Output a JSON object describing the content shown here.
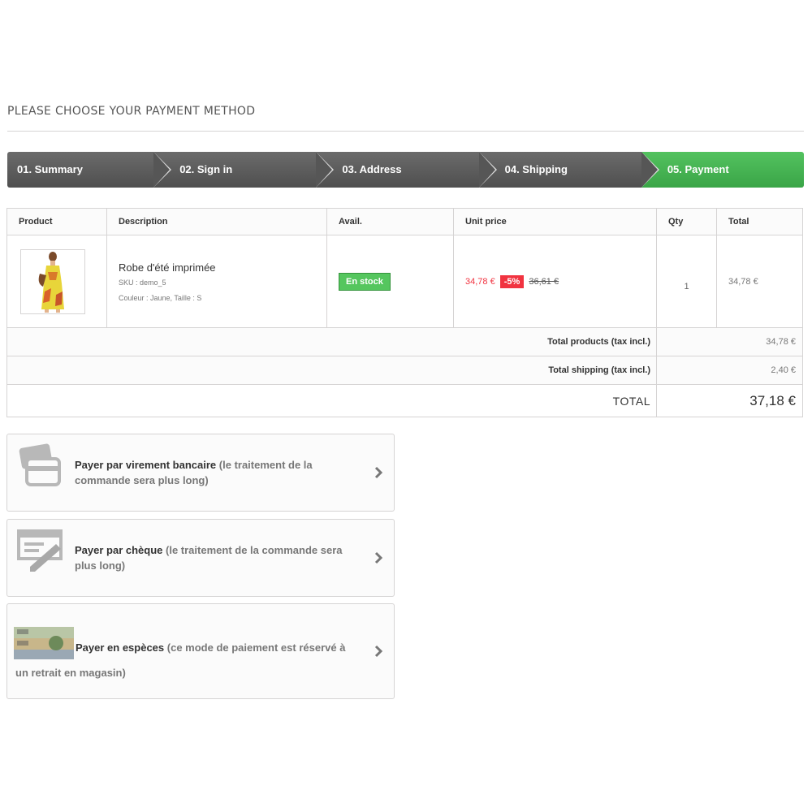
{
  "page": {
    "title": "PLEASE CHOOSE YOUR PAYMENT METHOD"
  },
  "steps": [
    {
      "label": "01. Summary",
      "active": false
    },
    {
      "label": "02. Sign in",
      "active": false
    },
    {
      "label": "03. Address",
      "active": false
    },
    {
      "label": "04. Shipping",
      "active": false
    },
    {
      "label": "05. Payment",
      "active": true
    }
  ],
  "cart": {
    "headers": [
      "Product",
      "Description",
      "Avail.",
      "Unit price",
      "Qty",
      "Total"
    ],
    "item": {
      "name": "Robe d'été imprimée",
      "sku": "SKU : demo_5",
      "attributes": "Couleur : Jaune, Taille : S",
      "availability": "En stock",
      "price": "34,78 €",
      "discount": "-5%",
      "old_price": "36,61 €",
      "qty": "1",
      "total": "34,78 €"
    },
    "summary": [
      {
        "label": "Total products (tax incl.)",
        "value": "34,78 €"
      },
      {
        "label": "Total shipping (tax incl.)",
        "value": "2,40 €"
      }
    ],
    "grand_total": {
      "label": "TOTAL",
      "value": "37,18 €"
    }
  },
  "payments": [
    {
      "title": "Payer par virement bancaire",
      "note": "(le traitement de la commande sera plus long)"
    },
    {
      "title": "Payer par chèque",
      "note": "(le traitement de la commande sera plus long)"
    },
    {
      "title": "Payer en espèces",
      "note": "(ce mode de paiement est réservé à un retrait en magasin)"
    }
  ],
  "colors": {
    "active_step": "#46b450",
    "inactive_step": "#5a5a5a",
    "stock_badge": "#55c65e",
    "discount": "#f13340"
  }
}
